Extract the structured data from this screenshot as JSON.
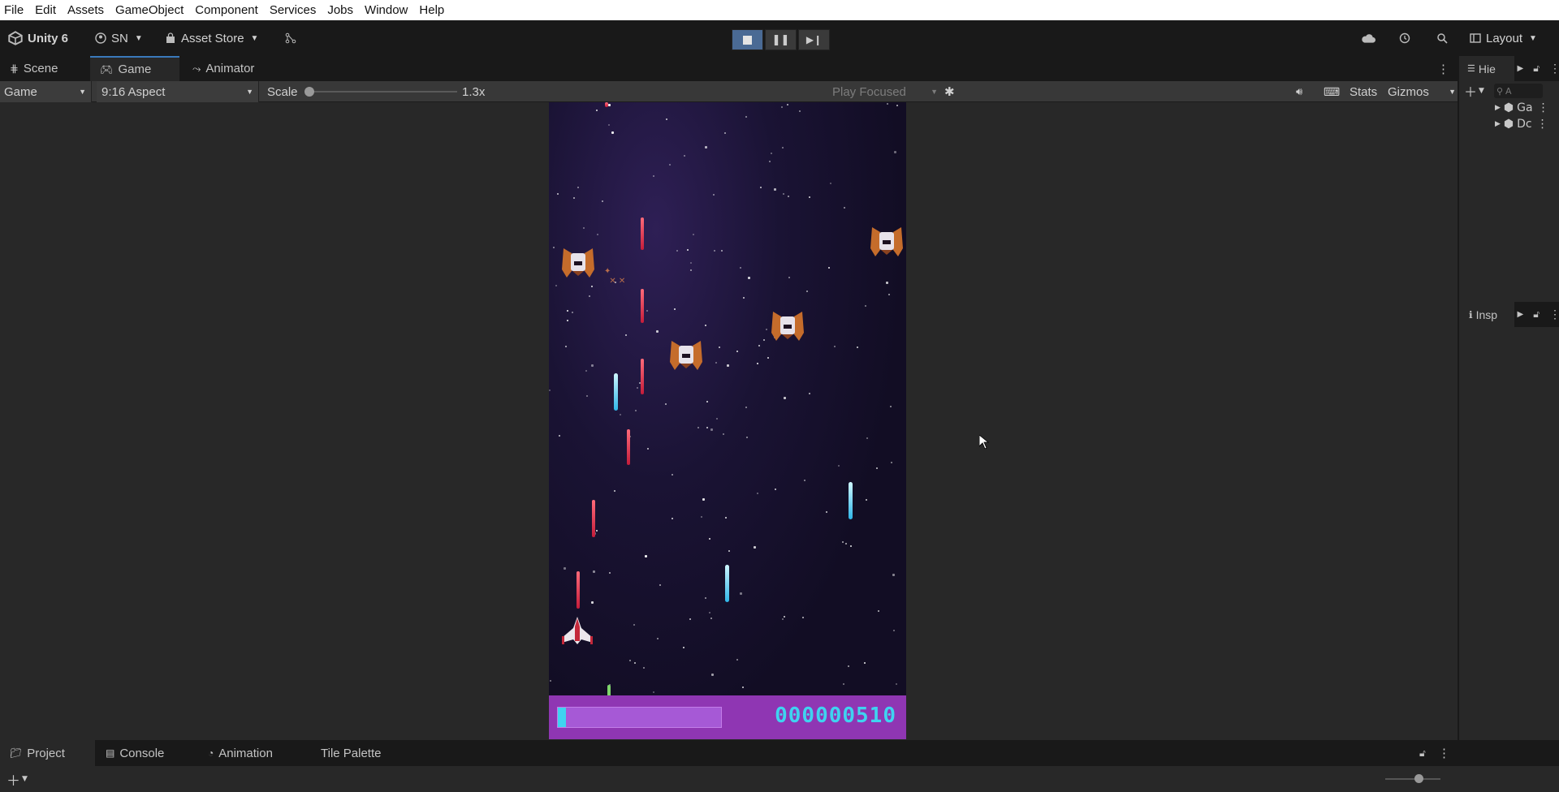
{
  "menu": [
    "File",
    "Edit",
    "Assets",
    "GameObject",
    "Component",
    "Services",
    "Jobs",
    "Window",
    "Help"
  ],
  "toolbar": {
    "unity_label": "Unity 6",
    "account": "SN",
    "asset_store": "Asset Store",
    "layout": "Layout"
  },
  "tabs": {
    "scene": "Scene",
    "game": "Game",
    "animator": "Animator"
  },
  "gamebar": {
    "display": "Game",
    "aspect": "9:16 Aspect",
    "scale_label": "Scale",
    "scale_value": "1.3x",
    "play_mode": "Play Focused",
    "stats": "Stats",
    "gizmos": "Gizmos"
  },
  "game": {
    "score": "000000510",
    "health_fraction": 0.05
  },
  "right_panel": {
    "hierarchy_tab": "Hie",
    "search_placeholder": "A",
    "items": [
      "Ga",
      "Dc"
    ],
    "inspector_tab": "Insp"
  },
  "bottom_tabs": {
    "project": "Project",
    "console": "Console",
    "animation": "Animation",
    "tile_palette": "Tile Palette"
  },
  "colors": {
    "accent": "#3a79bb",
    "hud": "#8f36b3",
    "hud_text": "#3fd3f0",
    "laser_red": "#e03050",
    "laser_blue": "#5bd1f2"
  }
}
